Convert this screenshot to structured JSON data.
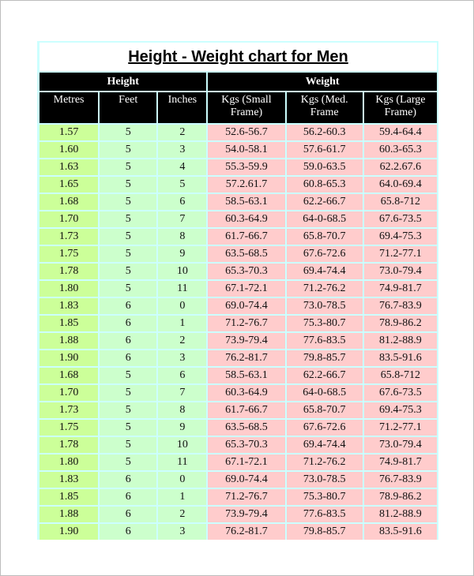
{
  "document": {
    "title": "Height - Weight chart for Men"
  },
  "table": {
    "group_headers": {
      "height": "Height",
      "weight": "Weight"
    },
    "columns": [
      "Metres",
      "Feet",
      "Inches",
      "Kgs (Small Frame)",
      "Kgs (Med. Frame",
      "Kgs (Large Frame)"
    ],
    "colors": {
      "header_bg": "#000000",
      "header_text": "#ffffff",
      "metres_bg": "#ccff99",
      "feet_inches_bg": "#ccffcc",
      "weight_bg": "#ffcccc",
      "grid": "#ccffff"
    },
    "rows": [
      [
        "1.57",
        "5",
        "2",
        "52.6-56.7",
        "56.2-60.3",
        "59.4-64.4"
      ],
      [
        "1.60",
        "5",
        "3",
        "54.0-58.1",
        "57.6-61.7",
        "60.3-65.3"
      ],
      [
        "1.63",
        "5",
        "4",
        "55.3-59.9",
        "59.0-63.5",
        "62.2.67.6"
      ],
      [
        "1.65",
        "5",
        "5",
        "57.2.61.7",
        "60.8-65.3",
        "64.0-69.4"
      ],
      [
        "1.68",
        "5",
        "6",
        "58.5-63.1",
        "62.2-66.7",
        "65.8-712"
      ],
      [
        "1.70",
        "5",
        "7",
        "60.3-64.9",
        "64-0-68.5",
        "67.6-73.5"
      ],
      [
        "1.73",
        "5",
        "8",
        "61.7-66.7",
        "65.8-70.7",
        "69.4-75.3"
      ],
      [
        "1.75",
        "5",
        "9",
        "63.5-68.5",
        "67.6-72.6",
        "71.2-77.1"
      ],
      [
        "1.78",
        "5",
        "10",
        "65.3-70.3",
        "69.4-74.4",
        "73.0-79.4"
      ],
      [
        "1.80",
        "5",
        "11",
        "67.1-72.1",
        "71.2-76.2",
        "74.9-81.7"
      ],
      [
        "1.83",
        "6",
        "0",
        "69.0-74.4",
        "73.0-78.5",
        "76.7-83.9"
      ],
      [
        "1.85",
        "6",
        "1",
        "71.2-76.7",
        "75.3-80.7",
        "78.9-86.2"
      ],
      [
        "1.88",
        "6",
        "2",
        "73.9-79.4",
        "77.6-83.5",
        "81.2-88.9"
      ],
      [
        "1.90",
        "6",
        "3",
        "76.2-81.7",
        "79.8-85.7",
        "83.5-91.6"
      ],
      [
        "1.68",
        "5",
        "6",
        "58.5-63.1",
        "62.2-66.7",
        "65.8-712"
      ],
      [
        "1.70",
        "5",
        "7",
        "60.3-64.9",
        "64-0-68.5",
        "67.6-73.5"
      ],
      [
        "1.73",
        "5",
        "8",
        "61.7-66.7",
        "65.8-70.7",
        "69.4-75.3"
      ],
      [
        "1.75",
        "5",
        "9",
        "63.5-68.5",
        "67.6-72.6",
        "71.2-77.1"
      ],
      [
        "1.78",
        "5",
        "10",
        "65.3-70.3",
        "69.4-74.4",
        "73.0-79.4"
      ],
      [
        "1.80",
        "5",
        "11",
        "67.1-72.1",
        "71.2-76.2",
        "74.9-81.7"
      ],
      [
        "1.83",
        "6",
        "0",
        "69.0-74.4",
        "73.0-78.5",
        "76.7-83.9"
      ],
      [
        "1.85",
        "6",
        "1",
        "71.2-76.7",
        "75.3-80.7",
        "78.9-86.2"
      ],
      [
        "1.88",
        "6",
        "2",
        "73.9-79.4",
        "77.6-83.5",
        "81.2-88.9"
      ],
      [
        "1.90",
        "6",
        "3",
        "76.2-81.7",
        "79.8-85.7",
        "83.5-91.6"
      ]
    ]
  }
}
